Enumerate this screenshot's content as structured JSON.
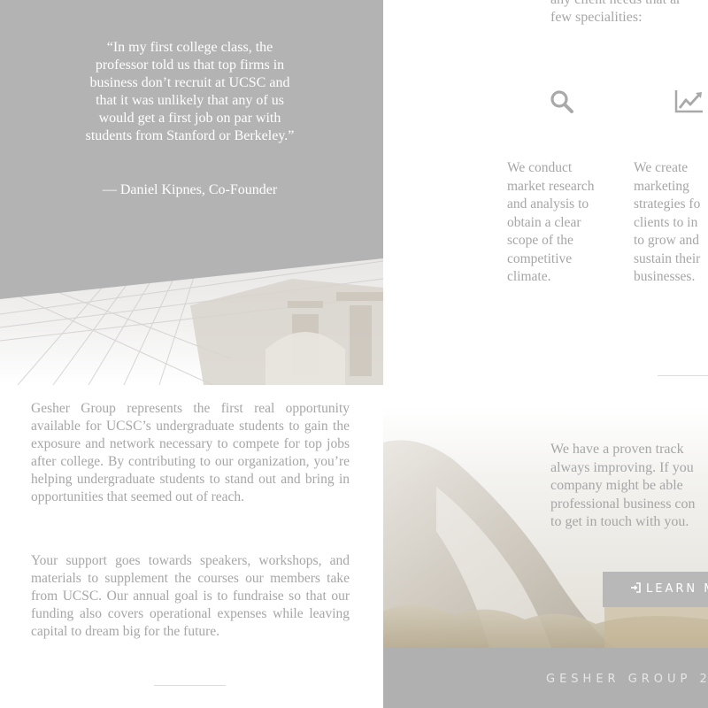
{
  "testimonial": {
    "quote": "“In my first college class, the professor told us that top firms in business don’t recruit at UCSC and that it was unlikely that any of us would get a first job on par with students from Stanford or Berkeley.”",
    "author": "— Daniel Kipnes, Co-Founder"
  },
  "about": {
    "paragraph_1": "Gesher Group represents the first real opportunity available for UCSC’s undergraduate students to gain the exposure and network necessary to compete for top jobs after college. By contributing to our organization, you’re helping undergraduate students to stand out and bring in opportunities that seemed out of reach.",
    "paragraph_2": "Your support goes towards speakers, workshops, and materials to supplement the courses our members take from UCSC. Our annual goal is to fundraise so that our funding also covers operational expenses while leaving capital to dream big for the future."
  },
  "services": {
    "intro_line_1": "any client needs that ar",
    "intro_line_2": "few specialities:",
    "items": [
      {
        "icon": "search-icon",
        "text": "We conduct market research and analysis to obtain a clear scope of the competitive climate."
      },
      {
        "icon": "chart-line-icon",
        "lines": [
          "We create",
          "marketing",
          "strategies fo",
          "clients to in",
          "to grow and",
          "sustain their",
          "businesses."
        ]
      }
    ]
  },
  "contact": {
    "lines": [
      "We have a proven track",
      "always improving. If you",
      "company might be able",
      "professional business con",
      "to get in touch with you."
    ],
    "button_label": "LEARN M",
    "button_icon": "sign-in-icon"
  },
  "footer": {
    "text": "GESHER GROUP 2"
  },
  "colors": {
    "panel_gray": "#b3b3b3",
    "text_gray": "#a6a6a6",
    "footer_gray": "#b0b0b0"
  }
}
